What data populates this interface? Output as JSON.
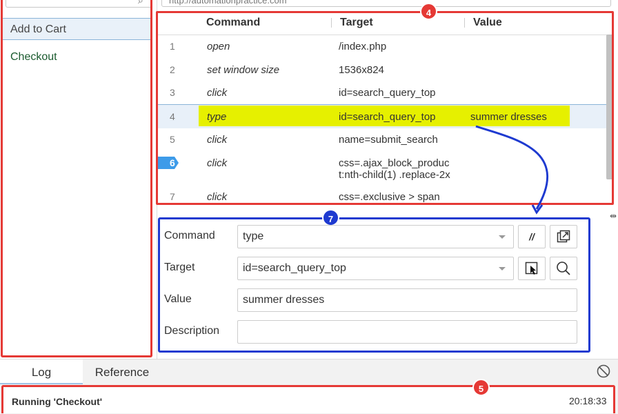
{
  "url_bar": {
    "value": "http://automationpractice.com"
  },
  "sidebar": {
    "tests": [
      {
        "name": "Add to Cart",
        "selected": true
      },
      {
        "name": "Checkout",
        "selected": false
      }
    ]
  },
  "table": {
    "headers": {
      "command": "Command",
      "target": "Target",
      "value": "Value"
    },
    "rows": [
      {
        "num": "1",
        "command": "open",
        "target": "/index.php",
        "value": ""
      },
      {
        "num": "2",
        "command": "set window size",
        "target": "1536x824",
        "value": ""
      },
      {
        "num": "3",
        "command": "click",
        "target": "id=search_query_top",
        "value": ""
      },
      {
        "num": "4",
        "command": "type",
        "target": "id=search_query_top",
        "value": "summer dresses"
      },
      {
        "num": "5",
        "command": "click",
        "target": "name=submit_search",
        "value": ""
      },
      {
        "num": "6",
        "command": "click",
        "target_line1": "css=.ajax_block_produc",
        "target_line2": "t:nth-child(1) .replace-2x",
        "value": ""
      },
      {
        "num": "7",
        "command": "click",
        "target": "css=.exclusive > span",
        "value": ""
      }
    ]
  },
  "editor": {
    "command_label": "Command",
    "command_value": "type",
    "comment_button": "//",
    "target_label": "Target",
    "target_value": "id=search_query_top",
    "value_label": "Value",
    "value_value": "summer dresses",
    "description_label": "Description",
    "description_value": ""
  },
  "bottom": {
    "tabs": {
      "log": "Log",
      "reference": "Reference"
    },
    "log_message": "Running 'Checkout'",
    "log_time": "20:18:33"
  },
  "annotations": {
    "badge_table": "4",
    "badge_editor": "7",
    "badge_log": "5"
  },
  "colors": {
    "annotation_red": "#e53935",
    "annotation_blue": "#1e3ad0",
    "highlight": "#e6f000",
    "selection": "#e8f0f9",
    "play_marker": "#3d9be9"
  },
  "icons": {
    "search": "search-icon",
    "open_window": "open-in-new-window-icon",
    "select_target": "select-target-cursor-icon",
    "find": "magnifier-icon",
    "clear_log": "clear-log-icon",
    "play_marker": "current-command-marker-icon"
  }
}
